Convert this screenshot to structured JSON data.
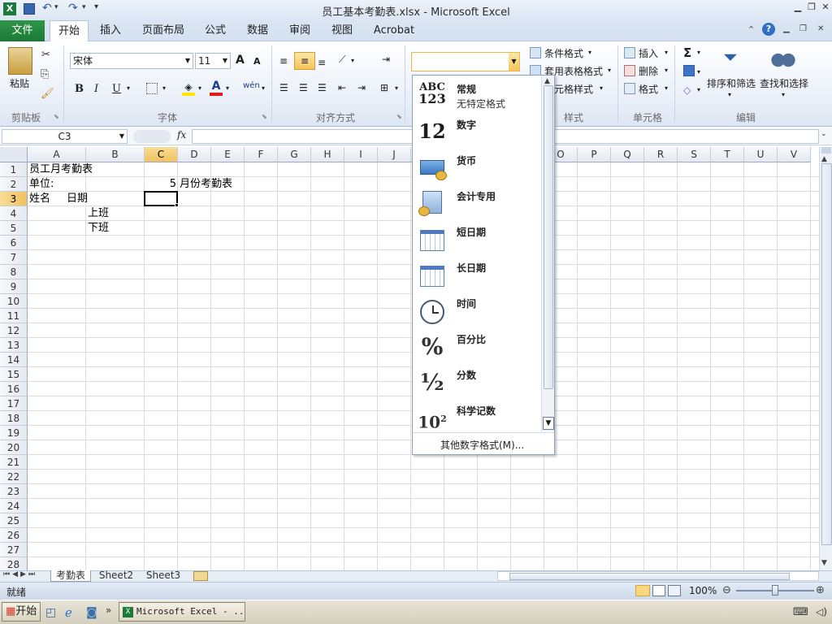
{
  "window": {
    "title": "员工基本考勤表.xlsx  -  Microsoft Excel",
    "qat_icons": [
      "excel-logo-icon",
      "save-icon",
      "undo-icon",
      "redo-icon",
      "customize-qat-icon"
    ],
    "controls": [
      "minimize-icon",
      "restore-icon",
      "close-icon"
    ]
  },
  "tabs": {
    "file": "文件",
    "items": [
      "开始",
      "插入",
      "页面布局",
      "公式",
      "数据",
      "审阅",
      "视图",
      "Acrobat"
    ],
    "active": "开始"
  },
  "ribbon": {
    "clipboard": {
      "paste": "粘贴",
      "group": "剪贴板"
    },
    "font": {
      "name": "宋体",
      "size": "11",
      "group": "字体",
      "bold": "B",
      "italic": "I",
      "underline": "U",
      "grow": "A",
      "shrink": "A",
      "phonetic": "wén"
    },
    "alignment": {
      "group": "对齐方式"
    },
    "number": {
      "format_value": "",
      "group": "数字"
    },
    "styles": {
      "conditional": "条件格式",
      "table": "套用表格格式",
      "cell_styles": "单元格样式",
      "group": "样式"
    },
    "cells": {
      "insert": "插入",
      "delete": "删除",
      "format": "格式",
      "group": "单元格"
    },
    "editing": {
      "sort": "排序和筛选",
      "find": "查找和选择",
      "group": "编辑",
      "sigma": "Σ"
    }
  },
  "formula_bar": {
    "namebox": "C3",
    "fx": "fx",
    "content": ""
  },
  "grid": {
    "columns": [
      "A",
      "B",
      "C",
      "D",
      "E",
      "F",
      "G",
      "H",
      "I",
      "J",
      "K",
      "L",
      "M",
      "N",
      "O",
      "P",
      "Q",
      "R",
      "S",
      "T",
      "U",
      "V"
    ],
    "selected_col": "C",
    "rows": [
      "1",
      "2",
      "3",
      "4",
      "5",
      "6",
      "7",
      "8",
      "9",
      "10",
      "11",
      "12",
      "13",
      "14",
      "15",
      "16",
      "17",
      "18",
      "19",
      "20",
      "21",
      "22",
      "23",
      "24",
      "25",
      "26",
      "27",
      "28"
    ],
    "selected_row": "3",
    "cells": {
      "a1": "员工月考勤表",
      "a2": "单位:",
      "c2": "5",
      "d2": "月份考勤表",
      "a3": "姓名",
      "a3b": "日期",
      "b4": "上班",
      "b5": "下班"
    }
  },
  "sheets": {
    "tabs": [
      "考勤表",
      "Sheet2",
      "Sheet3"
    ],
    "active": "考勤表"
  },
  "status": {
    "ready": "就绪",
    "zoom": "100%"
  },
  "number_format_menu": {
    "items": [
      {
        "name": "常规",
        "sample": "无特定格式",
        "icon": "abc-123-icon",
        "glyph1": "ABC",
        "glyph2": "123"
      },
      {
        "name": "数字",
        "sample": "",
        "icon": "number-12-icon",
        "glyph1": "12"
      },
      {
        "name": "货币",
        "sample": "",
        "icon": "currency-icon"
      },
      {
        "name": "会计专用",
        "sample": "",
        "icon": "accounting-icon"
      },
      {
        "name": "短日期",
        "sample": "",
        "icon": "short-date-calendar-icon"
      },
      {
        "name": "长日期",
        "sample": "",
        "icon": "long-date-calendar-icon"
      },
      {
        "name": "时间",
        "sample": "",
        "icon": "clock-icon"
      },
      {
        "name": "百分比",
        "sample": "",
        "icon": "percent-icon",
        "glyph1": "%"
      },
      {
        "name": "分数",
        "sample": "",
        "icon": "fraction-icon",
        "glyph1": "½"
      },
      {
        "name": "科学记数",
        "sample": "",
        "icon": "scientific-icon",
        "glyph1": "10",
        "glyph2": "2"
      }
    ],
    "more": "其他数字格式(M)..."
  },
  "taskbar": {
    "start": "开始",
    "task": "Microsoft Excel - ..."
  }
}
